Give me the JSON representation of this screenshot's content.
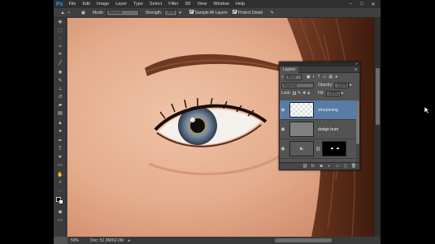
{
  "app": {
    "logo": "Ps",
    "menu": [
      "File",
      "Edit",
      "Image",
      "Layer",
      "Type",
      "Select",
      "Filter",
      "3D",
      "View",
      "Window",
      "Help"
    ],
    "window_controls": [
      "–",
      "□",
      "✕"
    ]
  },
  "options": {
    "mode_label": "Mode:",
    "mode_value": "Normal",
    "strength_label": "Strength:",
    "strength_value": "20%",
    "sample_all_layers": "Sample All Layers",
    "protect_detail": "Protect Detail"
  },
  "layers_panel": {
    "title": "Layers",
    "filter_kind": "Kind",
    "blend_mode": "Normal",
    "opacity_label": "Opacity:",
    "opacity_value": "100%",
    "lock_label": "Lock:",
    "fill_label": "Fill:",
    "fill_value": "100%",
    "layers": [
      {
        "name": "sharpening",
        "selected": true
      },
      {
        "name": "dodge burn",
        "selected": false
      },
      {
        "name": "",
        "selected": false
      }
    ]
  },
  "status": {
    "zoom": "50%",
    "doc": "Doc: 51.3M/62.0M"
  },
  "colors": {
    "accent": "#2f9cf3",
    "layer_selected": "#587ca6"
  }
}
